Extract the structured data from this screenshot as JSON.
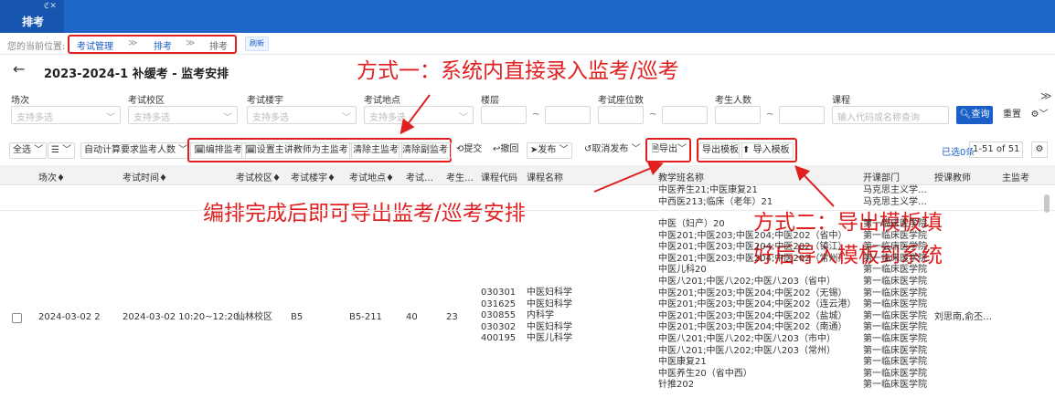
{
  "app": {
    "tab_title": "排考",
    "tab_icons": "ℭ✕"
  },
  "breadcrumb": {
    "prefix": "您的当前位置:",
    "items": [
      "考试管理",
      "排考",
      "排考"
    ],
    "separator": "≫",
    "refresh": "刷新"
  },
  "page": {
    "back": "←",
    "title": "2023-2024-1 补缓考 - 监考安排"
  },
  "annotations": {
    "method1": "方式一：系统内直接录入监考/巡考",
    "export_note": "编排完成后即可导出监考/巡考安排",
    "method2_line1": "方式二：导出模板填",
    "method2_line2": "好后导入模板到系统"
  },
  "filters": {
    "labels": [
      "场次",
      "考试校区",
      "考试楼宇",
      "考试地点",
      "楼层",
      "考试座位数",
      "考生人数",
      "课程"
    ],
    "multi_placeholder": "支持多选",
    "course_placeholder": "输入代码或名称查询",
    "tilde": "~",
    "query": "查询",
    "reset": "重置",
    "collapse": "≫"
  },
  "toolbar": {
    "select_all": "全选",
    "columns": "☰",
    "auto_calc": "自动计算要求监考人数",
    "edit_invig": "编排监考",
    "set_main": "设置主讲教师为主监考",
    "clear_main": "清除主监考",
    "clear_sub": "清除副监考",
    "submit": "提交",
    "revoke": "撤回",
    "publish": "发布",
    "cancel_publish": "取消发布",
    "export": "导出",
    "export_tpl": "导出模板",
    "import_tpl": "导入模板",
    "selected": "已选0条",
    "pager": "1-51 of 51"
  },
  "table": {
    "headers": [
      "场次♦",
      "考试时间♦",
      "考试校区♦",
      "考试楼宇♦",
      "考试地点♦",
      "考试…",
      "考生…",
      "课程代码",
      "课程名称",
      "教学班名称",
      "开课部门",
      "授课教师",
      "主监考"
    ],
    "partial_row": {
      "class_lines": [
        "中医养生21;中医康复21",
        "中西医213;临床（老年）21"
      ],
      "dept_lines": [
        "马克思主义学…",
        "马克思主义学…"
      ]
    },
    "row": {
      "session": "2024-03-02 2",
      "time": "2024-03-02 10:20~12:20",
      "campus": "仙林校区",
      "building": "B5",
      "location": "B5-211",
      "seats": "40",
      "students": "23",
      "codes": [
        "030301",
        "031625",
        "030855",
        "030302",
        "400195"
      ],
      "names": [
        "中医妇科学",
        "中医妇科学",
        "内科学",
        "中医妇科学",
        "中医儿科学"
      ],
      "classes": [
        "中医（妇产）20",
        "中医201;中医203;中医204;中医202（省中）",
        "中医201;中医203;中医204;中医202（镇江）",
        "中医201;中医203;中医204;中医202（常州）",
        "中医儿科20",
        "中医八201;中医八202;中医八203（省中）",
        "中医201;中医203;中医204;中医202（无锡）",
        "中医201;中医203;中医204;中医202（连云港）",
        "中医201;中医203;中医204;中医202（盐城）",
        "中医201;中医203;中医204;中医202（南通）",
        "中医八201;中医八202;中医八203（市中）",
        "中医八201;中医八202;中医八203（常州）",
        "中医康复21",
        "中医养生20（省中西）",
        "针推202"
      ],
      "dept_line": "第一临床医学院",
      "teacher": "刘思南,俞丕…"
    }
  }
}
